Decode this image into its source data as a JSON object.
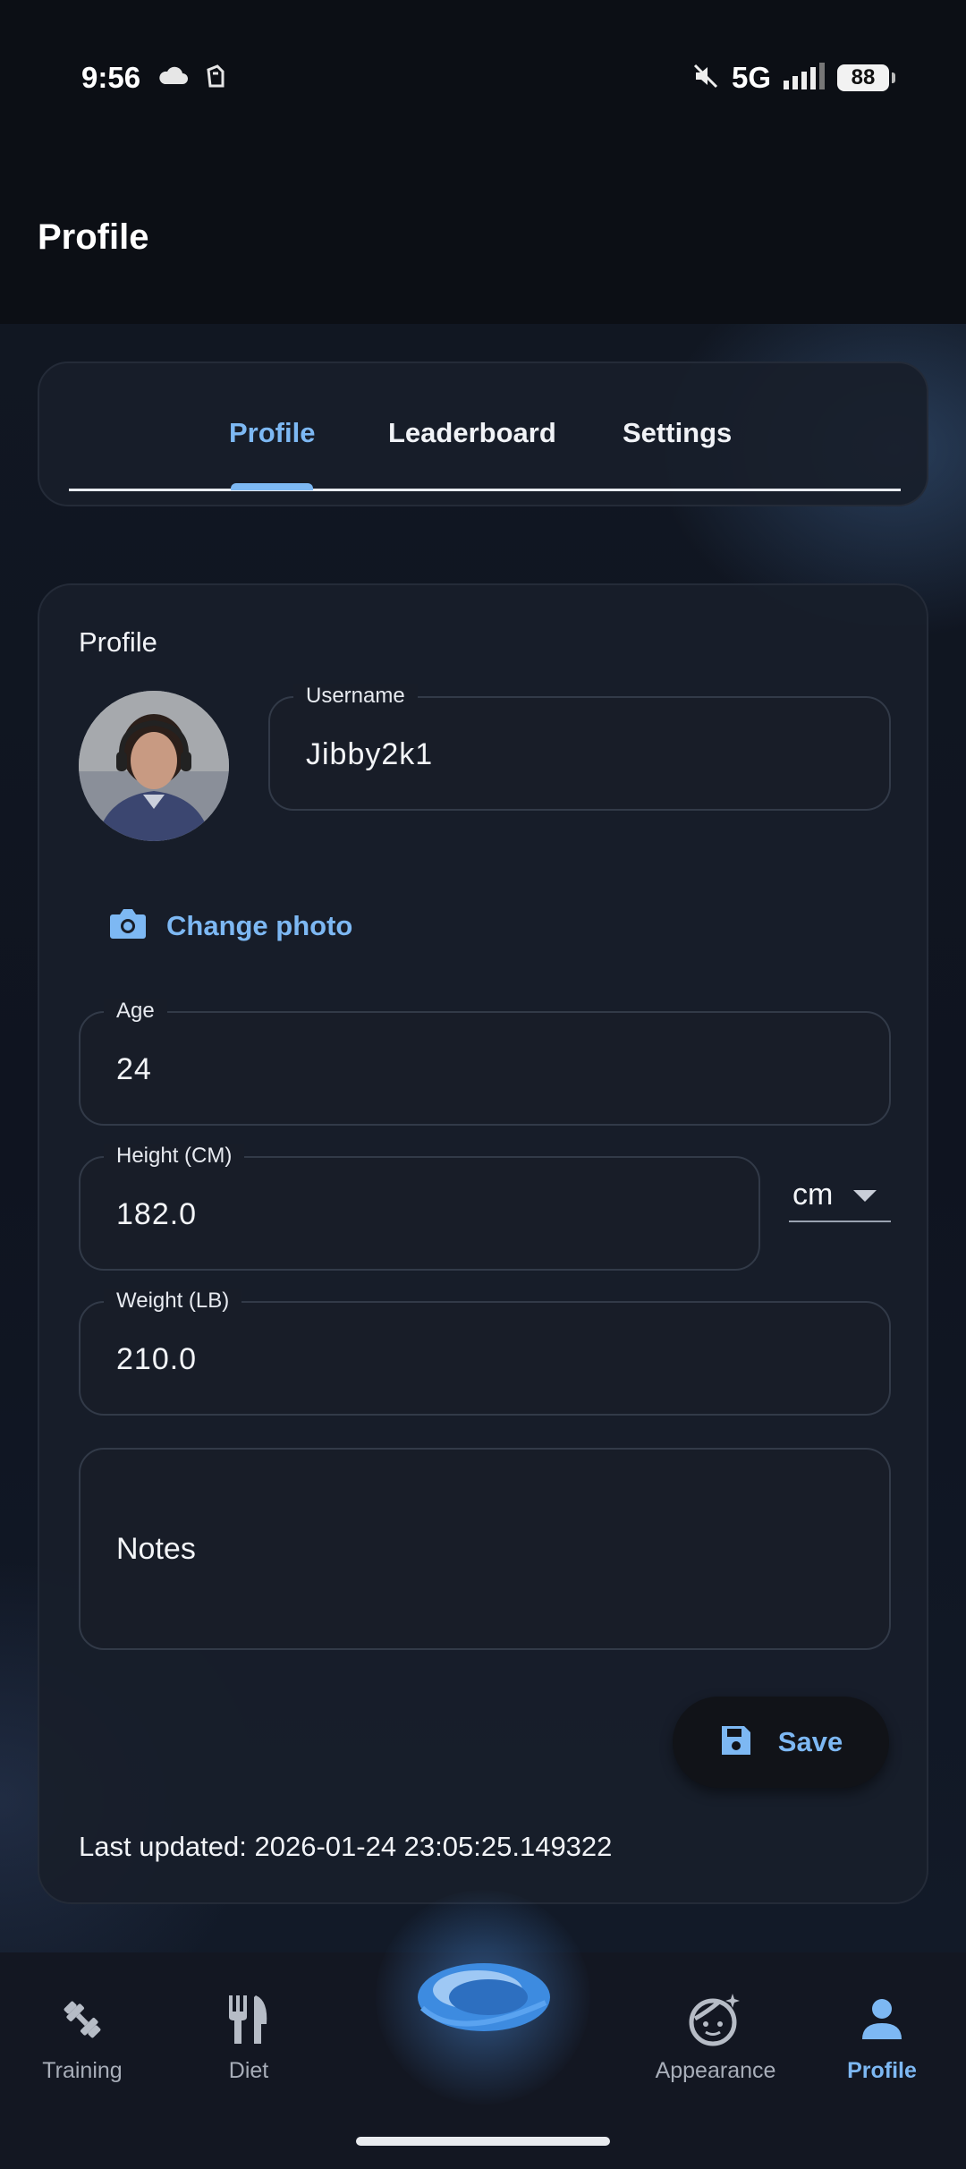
{
  "status_bar": {
    "time": "9:56",
    "network": "5G",
    "battery": "88",
    "icons": [
      "cloud-icon",
      "notification-icon",
      "mute-icon",
      "signal-icon",
      "battery-icon"
    ]
  },
  "header": {
    "title": "Profile"
  },
  "tabs": [
    {
      "label": "Profile",
      "active": true
    },
    {
      "label": "Leaderboard",
      "active": false
    },
    {
      "label": "Settings",
      "active": false
    }
  ],
  "profile": {
    "section_label": "Profile",
    "username": {
      "label": "Username",
      "value": "Jibby2k1"
    },
    "change_photo": "Change photo",
    "age": {
      "label": "Age",
      "value": "24"
    },
    "height": {
      "label": "Height (CM)",
      "value": "182.0",
      "unit": "cm"
    },
    "weight": {
      "label": "Weight (LB)",
      "value": "210.0"
    },
    "notes": {
      "label": "Notes",
      "value": ""
    },
    "save_label": "Save",
    "last_updated": "Last updated: 2026-01-24 23:05:25.149322"
  },
  "bottom_nav": [
    {
      "label": "Training",
      "icon": "dumbbell-icon",
      "active": false
    },
    {
      "label": "Diet",
      "icon": "fork-knife-icon",
      "active": false
    },
    {
      "label": "Appearance",
      "icon": "face-sparkle-icon",
      "active": false
    },
    {
      "label": "Profile",
      "icon": "person-icon",
      "active": true
    }
  ],
  "colors": {
    "accent": "#7db8f3",
    "background": "#0c0f15",
    "card": "#181d28"
  }
}
